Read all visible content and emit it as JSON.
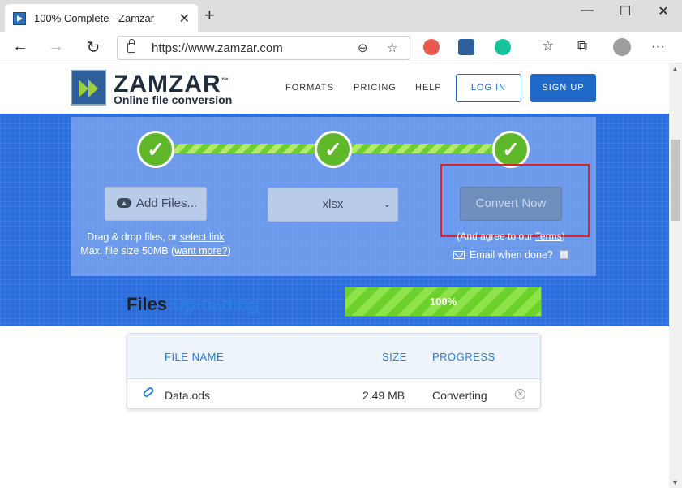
{
  "browser": {
    "tab_title": "100% Complete - Zamzar",
    "tab_close": "✕",
    "new_tab": "+",
    "url": "https://www.zamzar.com",
    "window_controls": {
      "minimize": "—",
      "maximize": "☐",
      "close": "✕"
    },
    "nav": {
      "back": "←",
      "forward": "→",
      "refresh": "↻"
    },
    "icons": {
      "zoom": "⊖",
      "favorite_add": "☆",
      "favorites": "☆",
      "collections": "⧉",
      "menu": "···"
    }
  },
  "site": {
    "logo_name": "ZAMZAR",
    "logo_tm": "™",
    "logo_tagline": "Online file conversion",
    "nav": [
      {
        "label": "FORMATS"
      },
      {
        "label": "PRICING"
      },
      {
        "label": "HELP"
      }
    ],
    "login_label": "LOG IN",
    "signup_label": "SIGN UP"
  },
  "converter": {
    "step_check": "✓",
    "add_files_label": "Add Files...",
    "drag_text_prefix": "Drag & drop files, or ",
    "select_link": "select link",
    "max_size_prefix": "Max. file size 50MB (",
    "want_more_link": "want more?",
    "max_size_suffix": ")",
    "format_value": "xlsx",
    "select_chevron": "⌄",
    "convert_label": "Convert Now",
    "terms_prefix": "(And agree to our ",
    "terms_link": "Terms",
    "terms_suffix": ")",
    "email_label": "Email when done?"
  },
  "files": {
    "title_main": "Files",
    "title_accent": "Uploading",
    "progress_label": "100%",
    "progress_value": 1.0,
    "columns": {
      "name": "FILE NAME",
      "size": "SIZE",
      "progress": "PROGRESS"
    },
    "rows": [
      {
        "name": "Data.ods",
        "size": "2.49 MB",
        "progress": "Converting",
        "remove": "✕"
      }
    ]
  },
  "colors": {
    "brand_blue": "#2a6ee0",
    "accent_green": "#6cd12a",
    "highlight_red": "#e0202a"
  }
}
